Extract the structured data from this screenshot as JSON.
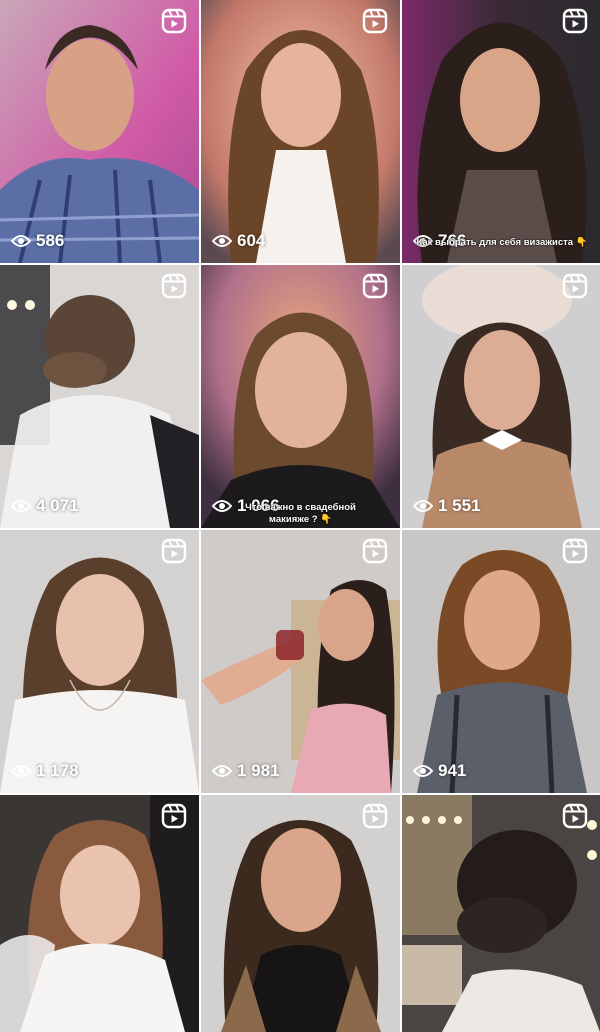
{
  "tiles": [
    {
      "views": "586",
      "caption": ""
    },
    {
      "views": "604",
      "caption": ""
    },
    {
      "views": "766",
      "caption": "Как выбрать для себя визажиста 👇"
    },
    {
      "views": "4 071",
      "caption": ""
    },
    {
      "views": "1 066",
      "caption": "Что важно в свадебной макияже ? 👇"
    },
    {
      "views": "1 551",
      "caption": ""
    },
    {
      "views": "1 178",
      "caption": ""
    },
    {
      "views": "1 981",
      "caption": ""
    },
    {
      "views": "941",
      "caption": ""
    },
    {
      "views": "",
      "caption": ""
    },
    {
      "views": "",
      "caption": ""
    },
    {
      "views": "",
      "caption": ""
    }
  ],
  "icons": {
    "reels": "reels-icon",
    "views": "eye-icon"
  },
  "colors": {
    "overlay_text": "#ffffff"
  }
}
